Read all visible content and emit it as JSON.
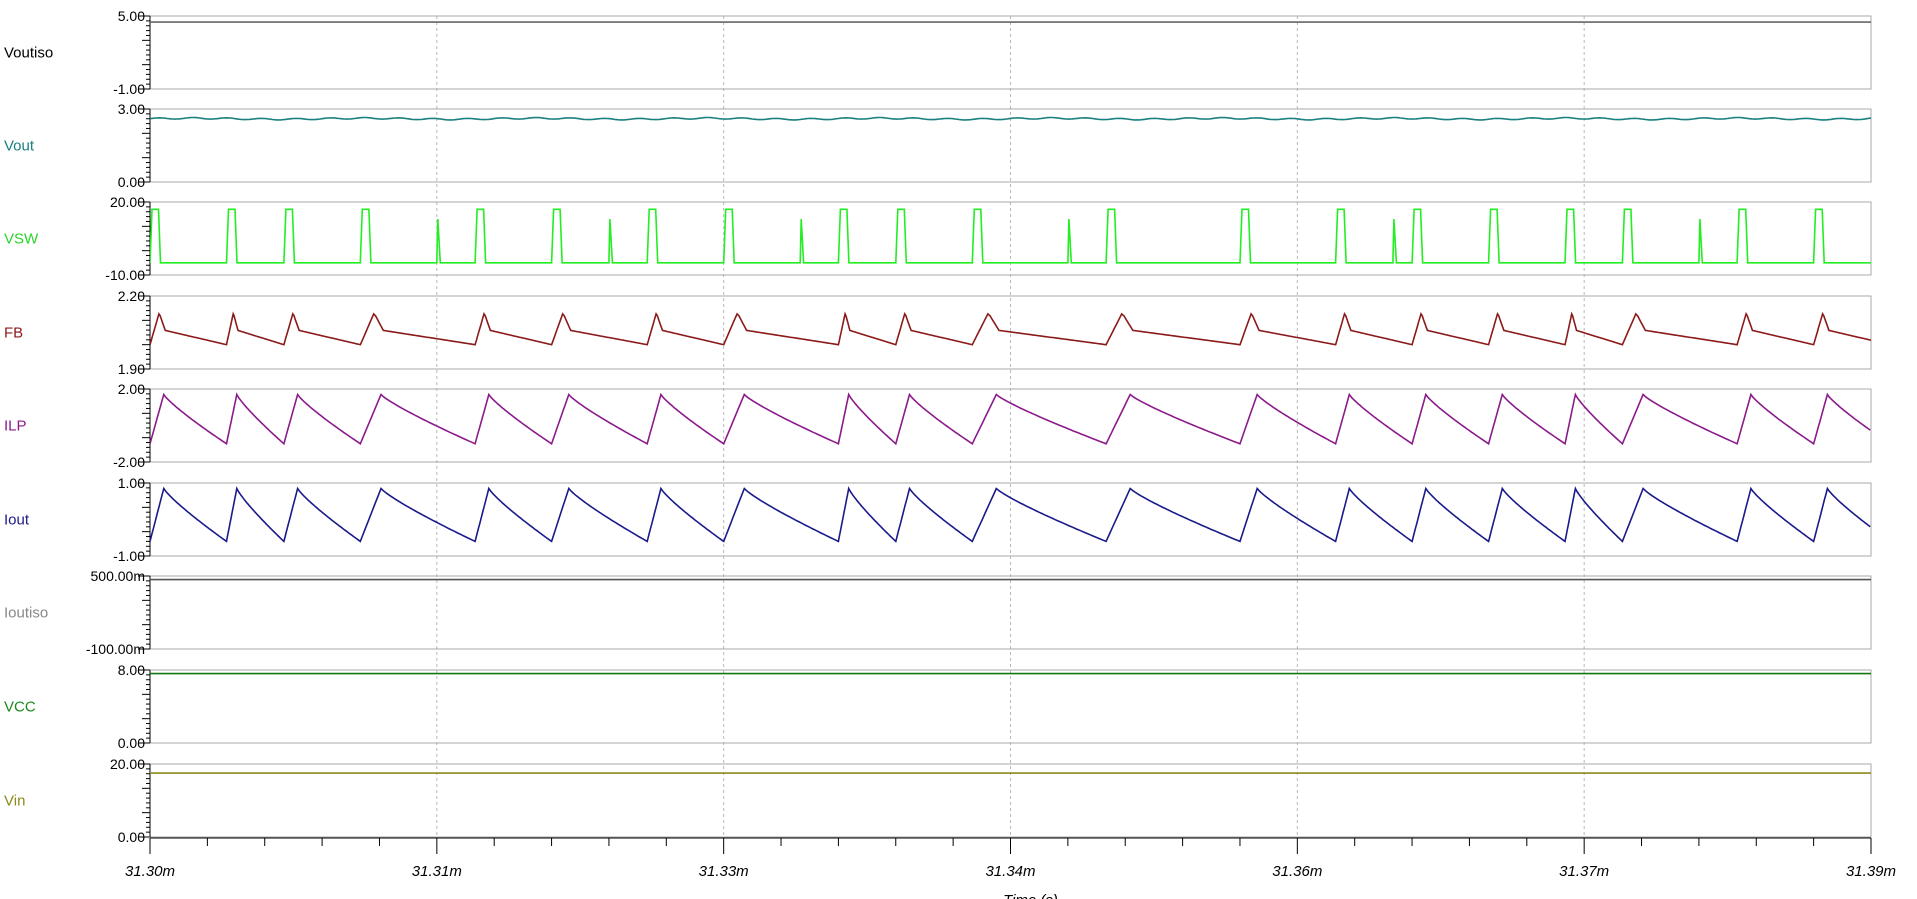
{
  "chart_data": {
    "type": "line",
    "x_unit": "s",
    "x_range": [
      0.0313,
      0.03139
    ],
    "x_ticks": [
      {
        "value": 0.0313,
        "label": "31.30m"
      },
      {
        "value": 0.031315,
        "label": "31.31m"
      },
      {
        "value": 0.03133,
        "label": "31.33m"
      },
      {
        "value": 0.031345,
        "label": "31.34m"
      },
      {
        "value": 0.03136,
        "label": "31.36m"
      },
      {
        "value": 0.031375,
        "label": "31.37m"
      },
      {
        "value": 0.03139,
        "label": "31.39m"
      }
    ],
    "xlabel": "Time (s)",
    "switching_events": [
      {
        "t": 0.0313,
        "kind": "full",
        "w": 5.5e-07
      },
      {
        "t": 0.031304,
        "kind": "full",
        "w": 5.5e-07
      },
      {
        "t": 0.031307,
        "kind": "full",
        "w": 5.5e-07
      },
      {
        "t": 0.031311,
        "kind": "full",
        "w": 5.5e-07
      },
      {
        "t": 0.031315,
        "kind": "spike",
        "w": 1.8e-07
      },
      {
        "t": 0.031317,
        "kind": "full",
        "w": 5.5e-07
      },
      {
        "t": 0.031321,
        "kind": "full",
        "w": 5.5e-07
      },
      {
        "t": 0.031324,
        "kind": "spike",
        "w": 1.8e-07
      },
      {
        "t": 0.031326,
        "kind": "full",
        "w": 5.5e-07
      },
      {
        "t": 0.03133,
        "kind": "full",
        "w": 5.5e-07
      },
      {
        "t": 0.031334,
        "kind": "spike",
        "w": 1.8e-07
      },
      {
        "t": 0.031336,
        "kind": "full",
        "w": 5.5e-07
      },
      {
        "t": 0.031339,
        "kind": "full",
        "w": 5.5e-07
      },
      {
        "t": 0.031343,
        "kind": "full",
        "w": 5.5e-07
      },
      {
        "t": 0.031348,
        "kind": "spike",
        "w": 1.8e-07
      },
      {
        "t": 0.03135,
        "kind": "full",
        "w": 5.5e-07
      },
      {
        "t": 0.031357,
        "kind": "full",
        "w": 5.5e-07
      },
      {
        "t": 0.031362,
        "kind": "full",
        "w": 5.5e-07
      },
      {
        "t": 0.031365,
        "kind": "spike",
        "w": 1.8e-07
      },
      {
        "t": 0.031366,
        "kind": "full",
        "w": 5.5e-07
      },
      {
        "t": 0.03137,
        "kind": "full",
        "w": 5.5e-07
      },
      {
        "t": 0.031374,
        "kind": "full",
        "w": 5.5e-07
      },
      {
        "t": 0.031377,
        "kind": "full",
        "w": 5.5e-07
      },
      {
        "t": 0.031381,
        "kind": "spike",
        "w": 1.8e-07
      },
      {
        "t": 0.031383,
        "kind": "full",
        "w": 5.5e-07
      },
      {
        "t": 0.031387,
        "kind": "full",
        "w": 5.5e-07
      },
      {
        "t": 0.031391,
        "kind": "full",
        "w": 5.5e-07
      }
    ],
    "panels": [
      {
        "name": "Voutiso",
        "color": "#000000",
        "ymax_label": "5.00",
        "ymin_label": "-1.00",
        "ylim": [
          -1,
          5
        ],
        "trace": {
          "kind": "flat",
          "level": 4.5,
          "color": "#666666"
        }
      },
      {
        "name": "Vout",
        "color": "#1a8080",
        "ymax_label": "3.00",
        "ymin_label": "0.00",
        "ylim": [
          0,
          3
        ],
        "trace": {
          "kind": "ripple",
          "level": 2.6,
          "ripple": 0.05,
          "color": "#1a8080"
        }
      },
      {
        "name": "VSW",
        "color": "#2ad62a",
        "ymax_label": "20.00",
        "ymin_label": "-10.00",
        "ylim": [
          -10,
          20
        ],
        "trace": {
          "kind": "switch",
          "low": -5,
          "high": 17,
          "color": "#22ee22"
        }
      },
      {
        "name": "FB",
        "color": "#8b1a1a",
        "ymax_label": "2.20",
        "ymin_label": "1.90",
        "ylim": [
          1.9,
          2.2
        ],
        "trace": {
          "kind": "fb",
          "base": 2.0,
          "peak": 2.13,
          "color": "#8b1a1a"
        }
      },
      {
        "name": "ILP",
        "color": "#8b1a8b",
        "ymax_label": "2.00",
        "ymin_label": "-2.00",
        "ylim": [
          -2,
          2
        ],
        "trace": {
          "kind": "saw",
          "min": -1.0,
          "max": 1.7,
          "color": "#8b1a8b"
        }
      },
      {
        "name": "Iout",
        "color": "#1a1a8b",
        "ymax_label": "1.00",
        "ymin_label": "-1.00",
        "ylim": [
          -1,
          1
        ],
        "trace": {
          "kind": "saw",
          "min": -0.6,
          "max": 0.85,
          "color": "#1a1a8b"
        }
      },
      {
        "name": "Ioutiso",
        "color": "#888888",
        "ymax_label": "500.00m",
        "ymin_label": "-100.00m",
        "ylim": [
          -0.1,
          0.5
        ],
        "trace": {
          "kind": "flat",
          "level": 0.47,
          "color": "#555555"
        }
      },
      {
        "name": "VCC",
        "color": "#1a8b1a",
        "ymax_label": "8.00",
        "ymin_label": "0.00",
        "ylim": [
          0,
          8
        ],
        "trace": {
          "kind": "flat",
          "level": 7.6,
          "color": "#117711"
        }
      },
      {
        "name": "Vin",
        "color": "#8b8b1a",
        "ymax_label": "20.00",
        "ymin_label": "0.00",
        "ylim": [
          0,
          20
        ],
        "trace": {
          "kind": "flat",
          "level": 17.5,
          "color": "#8b8b1a"
        }
      }
    ]
  }
}
